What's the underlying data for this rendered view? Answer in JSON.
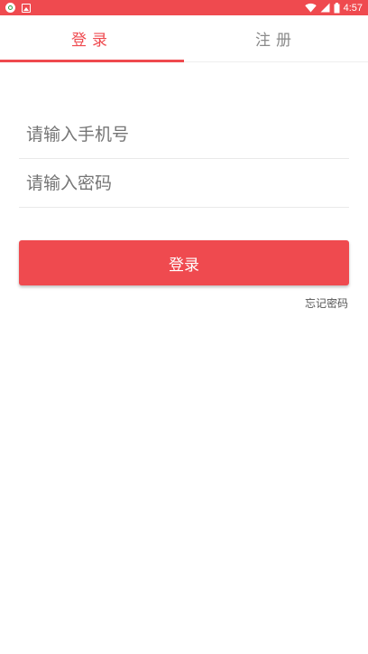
{
  "colors": {
    "accent": "#ef4a4f",
    "status_bar": "#ef4a4f",
    "tab_inactive": "#8a8a8a"
  },
  "status_bar": {
    "time": "4:57",
    "icons": [
      "app-notification-icon",
      "photo-notification-icon",
      "wifi-icon",
      "signal-icon",
      "battery-icon"
    ]
  },
  "tabs": [
    {
      "label": "登录",
      "active": true
    },
    {
      "label": "注册",
      "active": false
    }
  ],
  "form": {
    "phone_placeholder": "请输入手机号",
    "password_placeholder": "请输入密码",
    "phone_value": "",
    "password_value": ""
  },
  "login_button_label": "登录",
  "forgot_password_label": "忘记密码"
}
